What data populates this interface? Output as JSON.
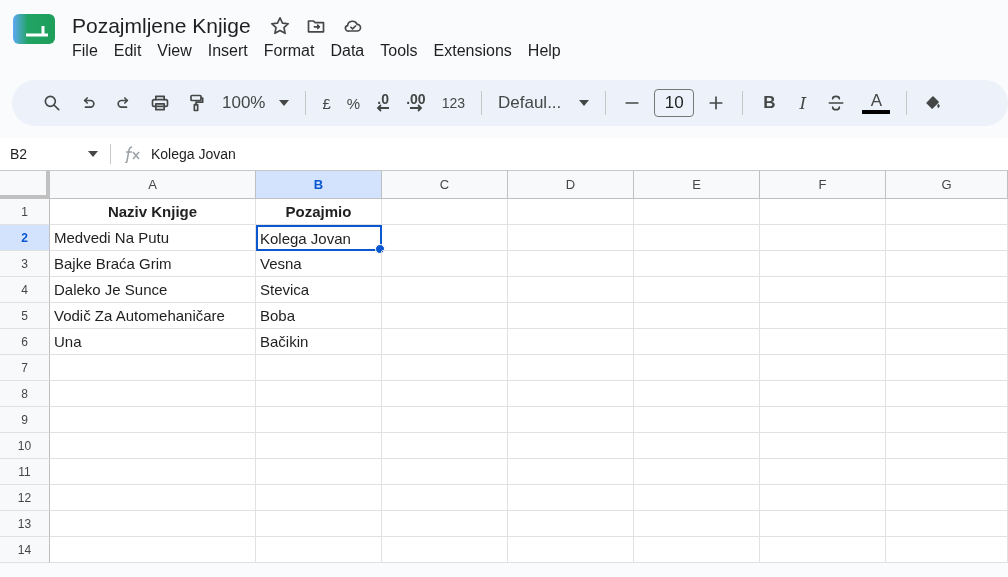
{
  "document": {
    "title": "Pozajmljene Knjige",
    "starred": false
  },
  "menu": [
    "File",
    "Edit",
    "View",
    "Insert",
    "Format",
    "Data",
    "Tools",
    "Extensions",
    "Help"
  ],
  "toolbar": {
    "zoom": "100%",
    "currency": "£",
    "percent": "%",
    "decrease_decimal": ".0",
    "increase_decimal": ".00",
    "number_format": "123",
    "font": "Defaul...",
    "font_size": "10",
    "bold": "B",
    "italic": "I",
    "text_color": "A"
  },
  "formula_bar": {
    "cell": "B2",
    "value": "Kolega Jovan"
  },
  "columns": [
    {
      "label": "A",
      "selected": false
    },
    {
      "label": "B",
      "selected": true
    },
    {
      "label": "C",
      "selected": false
    },
    {
      "label": "D",
      "selected": false
    },
    {
      "label": "E",
      "selected": false
    },
    {
      "label": "F",
      "selected": false
    },
    {
      "label": "G",
      "selected": false
    }
  ],
  "rows": [
    {
      "number": "1",
      "selected": false,
      "bold": true,
      "cells": [
        {
          "text": "Naziv Knjige",
          "selected": false
        },
        {
          "text": "Pozajmio",
          "selected": false
        }
      ]
    },
    {
      "number": "2",
      "selected": true,
      "bold": false,
      "cells": [
        {
          "text": "Medvedi Na Putu",
          "selected": false
        },
        {
          "text": "Kolega Jovan",
          "selected": true
        }
      ]
    },
    {
      "number": "3",
      "selected": false,
      "bold": false,
      "cells": [
        {
          "text": "Bajke Braća Grim",
          "selected": false
        },
        {
          "text": "Vesna",
          "selected": false
        }
      ]
    },
    {
      "number": "4",
      "selected": false,
      "bold": false,
      "cells": [
        {
          "text": "Daleko Je Sunce",
          "selected": false
        },
        {
          "text": "Stevica",
          "selected": false
        }
      ]
    },
    {
      "number": "5",
      "selected": false,
      "bold": false,
      "cells": [
        {
          "text": "Vodič Za Automehaničare",
          "selected": false
        },
        {
          "text": "Boba",
          "selected": false
        }
      ]
    },
    {
      "number": "6",
      "selected": false,
      "bold": false,
      "cells": [
        {
          "text": "Una",
          "selected": false
        },
        {
          "text": "Bačikin",
          "selected": false
        }
      ]
    },
    {
      "number": "7",
      "selected": false
    },
    {
      "number": "8",
      "selected": false
    },
    {
      "number": "9",
      "selected": false
    },
    {
      "number": "10",
      "selected": false
    },
    {
      "number": "11",
      "selected": false
    },
    {
      "number": "12",
      "selected": false
    },
    {
      "number": "13",
      "selected": false
    },
    {
      "number": "14",
      "selected": false
    }
  ]
}
